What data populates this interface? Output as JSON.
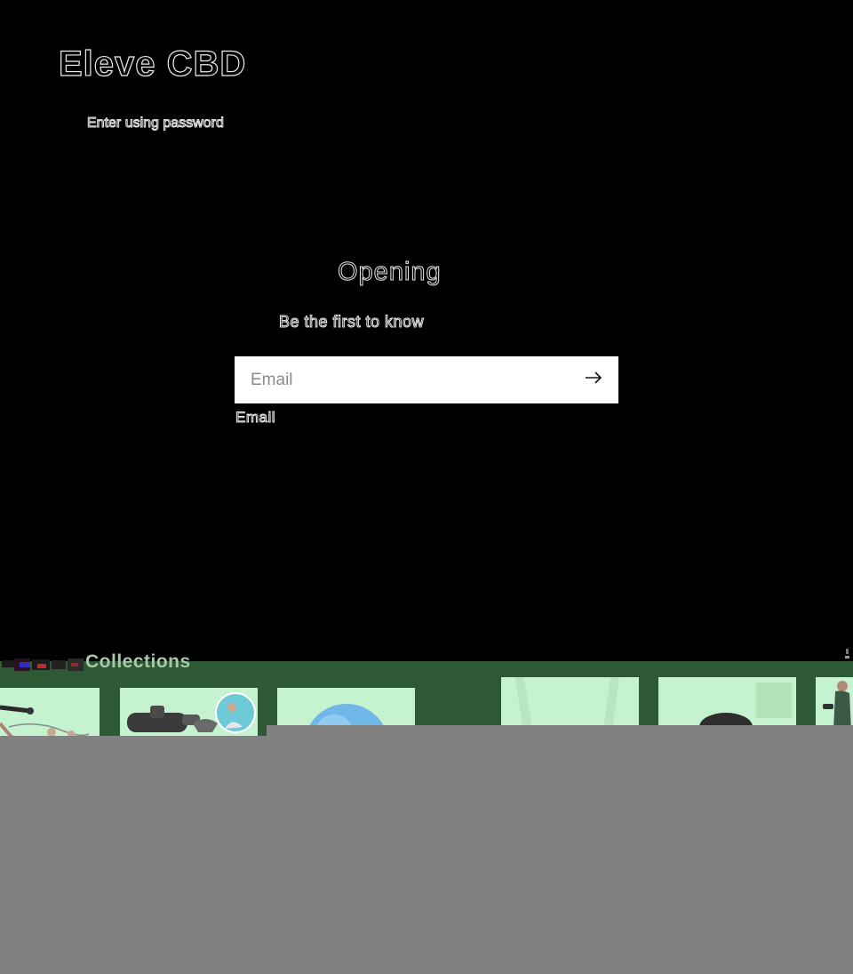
{
  "header": {
    "store_name": "Eleve CBD",
    "enter_password_link": "Enter using password"
  },
  "main": {
    "heading": "Opening",
    "subtitle": "Be the first to know",
    "email_placeholder": "Email",
    "email_label": "Email",
    "submit_icon": "arrow-right-icon"
  },
  "collections": {
    "title": "Collections",
    "cards": [
      {
        "name": "fitness-resistance-band"
      },
      {
        "name": "massage-gun-product"
      },
      {
        "name": "blue-exercise-ball"
      },
      {
        "name": "feet-product"
      },
      {
        "name": "black-massage-device"
      },
      {
        "name": "woman-fitness"
      }
    ]
  },
  "colors": {
    "background": "#000000",
    "band_green": "#2d5a34",
    "card_tint": "#c6f3cf",
    "footer_gray": "#818181",
    "input_bg": "#ffffff"
  }
}
